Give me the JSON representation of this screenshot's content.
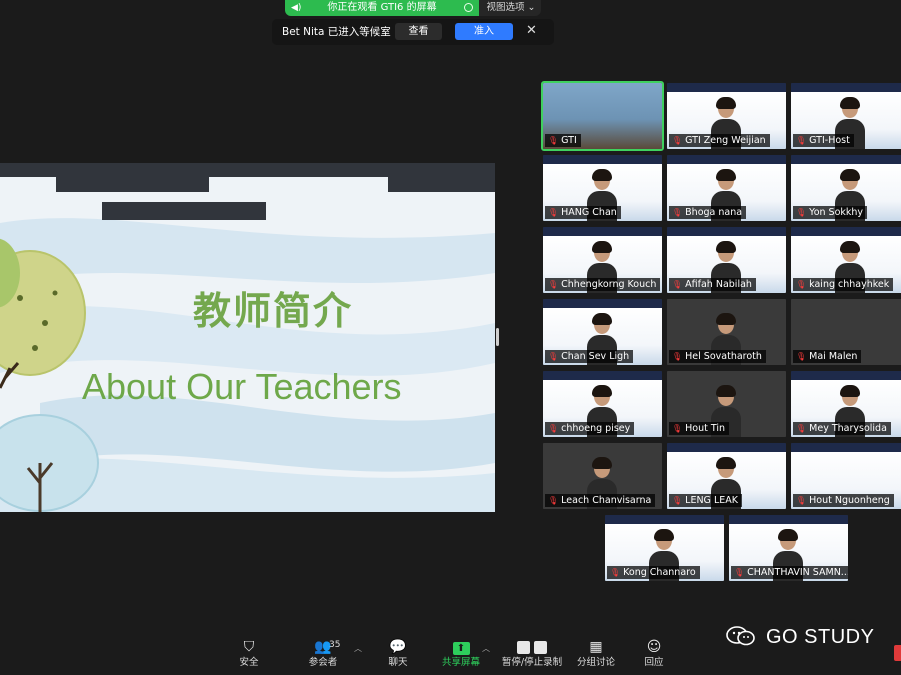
{
  "banner": {
    "viewing_text": "你正在观看 GTI6 的屏幕",
    "view_options": "视图选项 ⌄"
  },
  "waiting_notice": {
    "text": "Bet Nita 已进入等候室",
    "view_label": "查看",
    "admit_label": "准入"
  },
  "slide": {
    "title_cn": "教师简介",
    "title_en": "About Our Teachers"
  },
  "participants": [
    "GTI",
    "GTI Zeng Weijian",
    "GTI-Host",
    "HANG Chan",
    "Bhoga nana",
    "Yon Sokkhy",
    "Chhengkorng Kouch",
    "Afifah Nabilah",
    "kaing chhayhkek",
    "Chan Sev Ligh",
    "Hel Sovatharoth",
    "Mai Malen",
    "chhoeng pisey",
    "Hout Tin",
    "Mey Tharysolida",
    "Leach Chanvisarna",
    "LENG LEAK",
    "Hout Nguonheng",
    "Kong Channaro",
    "CHANTHAVIN SAMN..."
  ],
  "toolbar": {
    "security": "安全",
    "participants": "参会者",
    "participant_count": "35",
    "chat": "聊天",
    "share": "共享屏幕",
    "record": "暂停/停止录制",
    "breakout": "分组讨论",
    "reactions": "回应"
  },
  "watermark": {
    "text": "GO STUDY"
  },
  "colors": {
    "accent_green": "#2ecf5c",
    "admit_blue": "#2f7bff",
    "slide_text_green": "#6ea84a",
    "muted_red": "#ff3b3b"
  }
}
